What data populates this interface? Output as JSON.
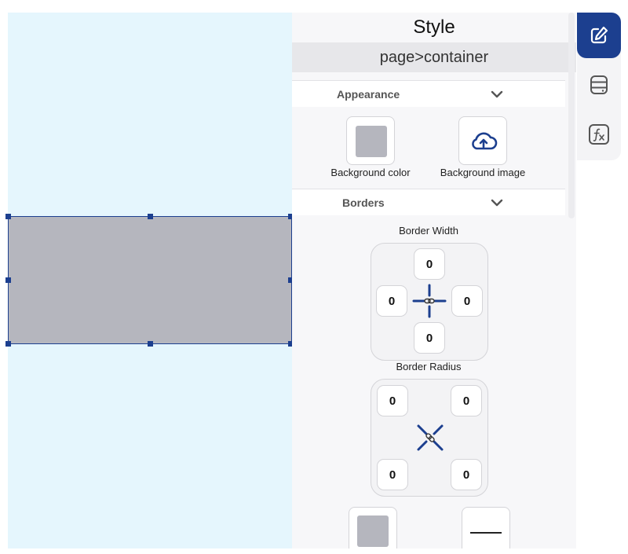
{
  "panel": {
    "title": "Style",
    "breadcrumb": "page>container"
  },
  "appearance": {
    "header": "Appearance",
    "background_color_label": "Background color",
    "background_image_label": "Background image"
  },
  "borders": {
    "header": "Borders",
    "width_label": "Border Width",
    "width": {
      "top": "0",
      "left": "0",
      "right": "0",
      "bottom": "0"
    },
    "radius_label": "Border Radius",
    "radius": {
      "top_left": "0",
      "top_right": "0",
      "bottom_left": "0",
      "bottom_right": "0"
    }
  },
  "tabs": [
    {
      "icon": "edit-icon",
      "active": true
    },
    {
      "icon": "database-icon",
      "active": false
    },
    {
      "icon": "function-icon",
      "active": false
    }
  ],
  "colors": {
    "accent": "#1c3f8f",
    "canvas": "#e5f6fd",
    "element_fill": "#b5b6be"
  }
}
